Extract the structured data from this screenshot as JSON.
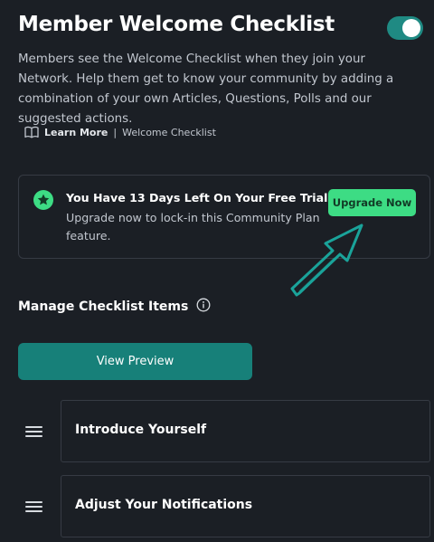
{
  "header": {
    "title": "Member Welcome Checklist",
    "toggle_on": true,
    "description": "Members see the Welcome Checklist when they join your Network. Help them get to know your community by adding a combination of your own Articles, Questions, Polls and our suggested actions."
  },
  "learn_more": {
    "icon": "book-icon",
    "link_label": "Learn More",
    "separator": "|",
    "topic": "Welcome Checklist"
  },
  "trial": {
    "icon": "star-icon",
    "title": "You Have 13 Days Left On Your Free Trial",
    "subtitle": "Upgrade now to lock-in this Community Plan feature.",
    "button_label": "Upgrade Now",
    "accent_color": "#3ddc84"
  },
  "manage": {
    "label": "Manage Checklist Items",
    "info_icon": "info-icon",
    "preview_button_label": "View Preview",
    "preview_color": "#178079",
    "items": [
      {
        "label": "Introduce Yourself"
      },
      {
        "label": "Adjust Your Notifications"
      }
    ]
  }
}
